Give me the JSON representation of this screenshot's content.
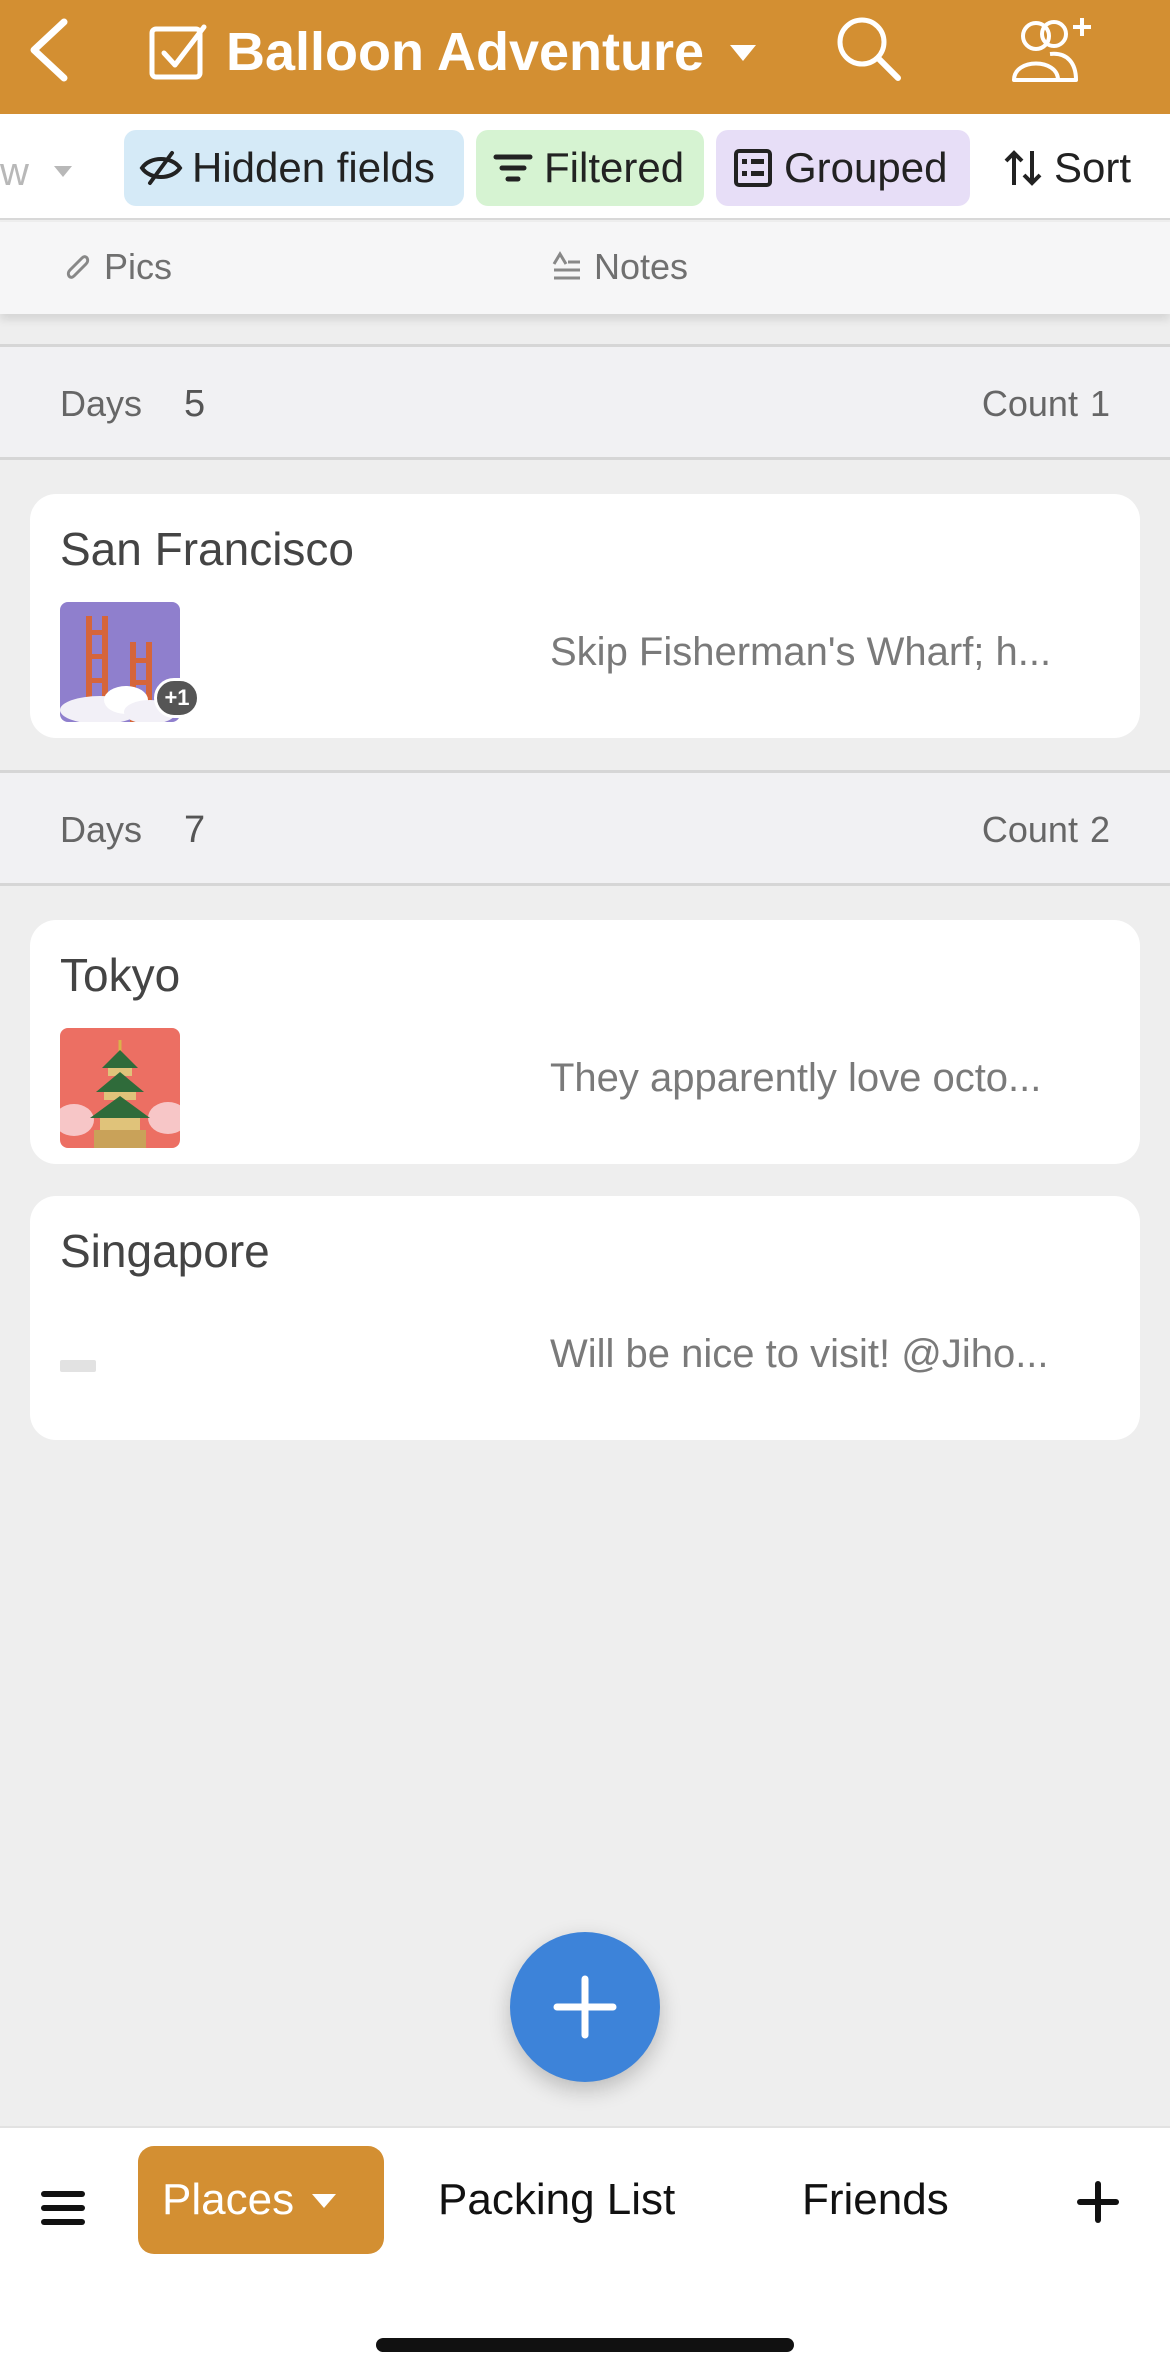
{
  "colors": {
    "accent": "#d38f32",
    "fab": "#3d83d9",
    "hidden_chip": "#d5eaf7",
    "filtered_chip": "#d6f3d2",
    "grouped_chip": "#e7def7"
  },
  "header": {
    "title": "Balloon Adventure",
    "icons": [
      "back-icon",
      "checkbox-icon",
      "chevron-down-icon",
      "search-icon",
      "share-users-icon"
    ]
  },
  "viewbar": {
    "partial_view_label": "w",
    "hidden_fields": "Hidden fields",
    "filtered": "Filtered",
    "grouped": "Grouped",
    "sort": "Sort"
  },
  "columns": {
    "pics": "Pics",
    "notes": "Notes"
  },
  "groups": [
    {
      "field": "Days",
      "value": "5",
      "count_label": "Count",
      "count": "1",
      "records": [
        {
          "name": "San Francisco",
          "thumb_icon": "golden-gate-bridge-thumbnail",
          "extra_attachments": "+1",
          "note": "Skip Fisherman's Wharf; h..."
        }
      ]
    },
    {
      "field": "Days",
      "value": "7",
      "count_label": "Count",
      "count": "2",
      "records": [
        {
          "name": "Tokyo",
          "thumb_icon": "pagoda-thumbnail",
          "note": "They apparently love octo..."
        },
        {
          "name": "Singapore",
          "note": "Will be nice to visit! @Jiho..."
        }
      ]
    }
  ],
  "tabbar": {
    "tabs": [
      "Places",
      "Packing List",
      "Friends"
    ],
    "active_tab": "Places"
  }
}
